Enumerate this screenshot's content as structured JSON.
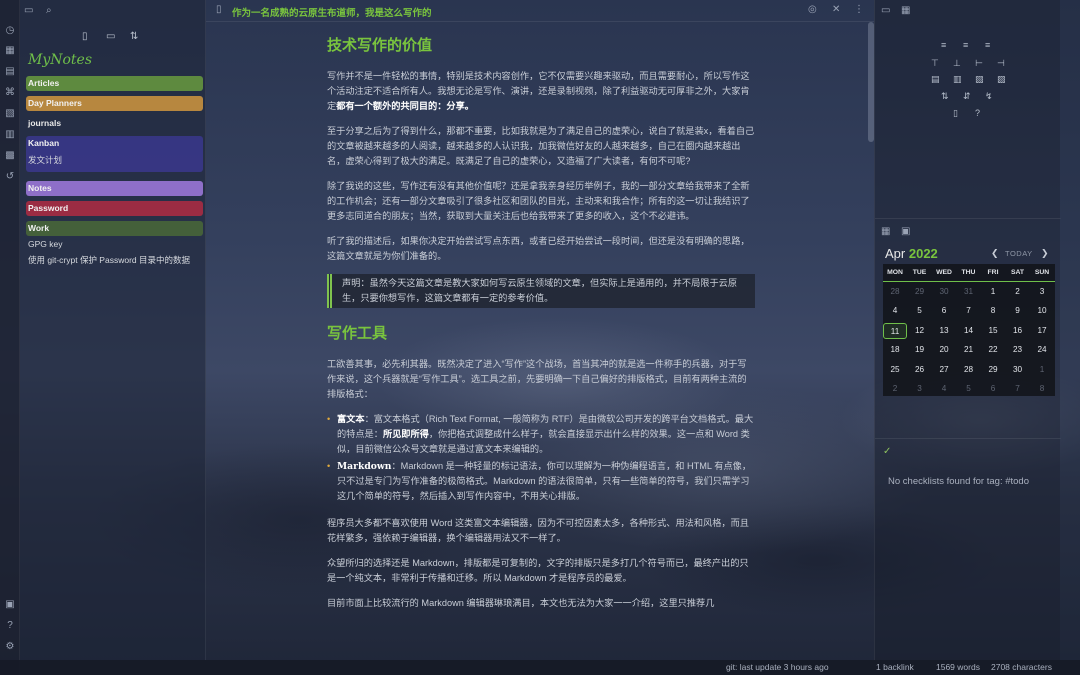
{
  "explorer": {
    "vault_name": "MyNotes",
    "folders": [
      {
        "label": "Articles",
        "color": "#5e8a3f"
      },
      {
        "label": "Day Planners",
        "color": "#b7873f"
      },
      {
        "label": "journals",
        "color": ""
      },
      {
        "label": "Kanban",
        "color": "#4b3ec2"
      },
      {
        "label": "Notes",
        "color": "#8e6fc8"
      },
      {
        "label": "Password",
        "color": "#9b2c43"
      },
      {
        "label": "Work",
        "color": "#44603a"
      }
    ],
    "files": {
      "kanban_file": "发文计划",
      "work_file_1": "GPG key",
      "work_file_2": "使用 git-crypt 保护 Password 目录中的数据"
    }
  },
  "tab": {
    "title": "作为一名成熟的云原生布道师，我是这么写作的"
  },
  "editor": {
    "h1": "技术写作的价值",
    "p1a": "写作并不是一件轻松的事情，特别是技术内容创作，它不仅需要兴趣来驱动，而且需要耐心，所以写作这个活动注定不适合所有人。我想无论是写作、演讲，还是录制视频，除了利益驱动无可厚非之外，大家肯定",
    "p1b": "都有一个额外的共同目的：分享。",
    "p2": "至于分享之后为了得到什么，那都不重要，比如我就是为了满足自己的虚荣心，说白了就是装x，看着自己的文章被越来越多的人阅读，越来越多的人认识我，加我微信好友的人越来越多，自己在圈内越来越出名，虚荣心得到了极大的满足。既满足了自己的虚荣心，又造福了广大读者，有何不可呢?",
    "p3": "除了我说的这些，写作还有没有其他价值呢？还是拿我亲身经历举例子，我的一部分文章给我带来了全新的工作机会；还有一部分文章吸引了很多社区和团队的目光，主动来和我合作；所有的这一切让我结识了更多志同道合的朋友；当然，获取到大量关注后也给我带来了更多的收入，这个不必避讳。",
    "p4": "听了我的描述后，如果你决定开始尝试写点东西，或者已经开始尝试一段时间，但还是没有明确的思路，这篇文章就是为你们准备的。",
    "callout": "声明：虽然今天这篇文章是教大家如何写云原生领域的文章，但实际上是通用的，并不局限于云原生，只要你想写作，这篇文章都有一定的参考价值。",
    "h2": "写作工具",
    "p5": "工欲善其事，必先利其器。既然决定了进入“写作”这个战场，首当其冲的就是选一件称手的兵器，对于写作来说，这个兵器就是“写作工具”。选工具之前，先要明确一下自己偏好的排版格式，目前有两种主流的排版格式：",
    "li1_key": "富文本",
    "li1_a": "：富文本格式（Rich Text Format, 一般简称为 RTF）是由微软公司开发的跨平台文档格式。最大的特点是：",
    "li1_bold": "所见即所得",
    "li1_b": "，你把格式调整成什么样子，就会直接显示出什么样的效果。这一点和 Word 类似，目前微信公众号文章就是通过富文本来编辑的。",
    "li2_key": "Markdown",
    "li2_a": "：Markdown 是一种轻量的标记语法，你可以理解为一种伪编程语言，和 HTML 有点像，只不过是专门为写作准备的极简格式。Markdown 的语法很简单，只有一些简单的符号，我们只需学习这几个简单的符号，然后插入到写作内容中，不用关心排版。",
    "p6": "程序员大多都不喜欢使用 Word 这类富文本编辑器，因为不可控因素太多，各种形式、用法和风格，而且花样繁多，强依赖于编辑器，换个编辑器用法又不一样了。",
    "p7": "众望所归的选择还是 Markdown，排版都是可复制的，文字的排版只是多打几个符号而已，最终产出的只是一个纯文本，非常利于传播和迁移。所以 Markdown 才是程序员的最爱。",
    "p8": "目前市面上比较流行的 Markdown 编辑器琳琅满目，本文也无法为大家一一介绍，这里只推荐几"
  },
  "calendar": {
    "month": "Apr",
    "year": "2022",
    "today_label": "TODAY",
    "weekdays": [
      "MON",
      "TUE",
      "WED",
      "THU",
      "FRI",
      "SAT",
      "SUN"
    ],
    "days": [
      [
        "28",
        "29",
        "30",
        "31",
        "1",
        "2",
        "3"
      ],
      [
        "4",
        "5",
        "6",
        "7",
        "8",
        "9",
        "10"
      ],
      [
        "11",
        "12",
        "13",
        "14",
        "15",
        "16",
        "17"
      ],
      [
        "18",
        "19",
        "20",
        "21",
        "22",
        "23",
        "24"
      ],
      [
        "25",
        "26",
        "27",
        "28",
        "29",
        "30",
        "1"
      ],
      [
        "2",
        "3",
        "4",
        "5",
        "6",
        "7",
        "8"
      ]
    ],
    "today": "11"
  },
  "checklist": {
    "empty_message": "No checklists found for tag: #todo"
  },
  "status": {
    "git": "git: last update 3 hours ago",
    "backlinks": "1 backlink",
    "words": "1569 words",
    "characters": "2708 characters"
  },
  "colors": {
    "accent_green": "#79c43e",
    "today_border": "#6fbf4a"
  }
}
